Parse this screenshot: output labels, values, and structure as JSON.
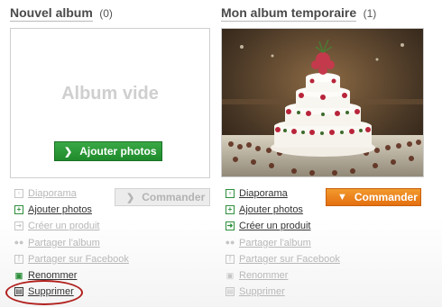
{
  "albums": [
    {
      "title": "Nouvel album",
      "count": "(0)",
      "empty_text": "Album vide",
      "add_button": "Ajouter photos",
      "command_button": "Commander",
      "actions": [
        {
          "label": "Diaporama",
          "icon": "slideshow-icon",
          "enabled": false
        },
        {
          "label": "Ajouter photos",
          "icon": "add-photo-icon",
          "enabled": true
        },
        {
          "label": "Créer un produit",
          "icon": "create-product-icon",
          "enabled": false
        },
        {
          "label": "Partager l'album",
          "icon": "share-users-icon",
          "enabled": false
        },
        {
          "label": "Partager sur Facebook",
          "icon": "facebook-icon",
          "enabled": false
        },
        {
          "label": "Renommer",
          "icon": "rename-icon",
          "enabled": true
        },
        {
          "label": "Supprimer",
          "icon": "trash-icon",
          "enabled": true
        }
      ]
    },
    {
      "title": "Mon album temporaire",
      "count": "(1)",
      "command_button": "Commander",
      "actions": [
        {
          "label": "Diaporama",
          "icon": "slideshow-icon",
          "enabled": true
        },
        {
          "label": "Ajouter photos",
          "icon": "add-photo-icon",
          "enabled": true
        },
        {
          "label": "Créer un produit",
          "icon": "create-product-icon",
          "enabled": true
        },
        {
          "label": "Partager l'album",
          "icon": "share-users-icon",
          "enabled": false
        },
        {
          "label": "Partager sur Facebook",
          "icon": "facebook-icon",
          "enabled": false
        },
        {
          "label": "Renommer",
          "icon": "rename-icon",
          "enabled": false
        },
        {
          "label": "Supprimer",
          "icon": "trash-icon",
          "enabled": false
        }
      ]
    }
  ],
  "colors": {
    "green_button": "#2a9a37",
    "orange_button": "#ea7d1a",
    "highlight_ring": "#b0201d",
    "disabled_text": "#b8b8b8"
  }
}
